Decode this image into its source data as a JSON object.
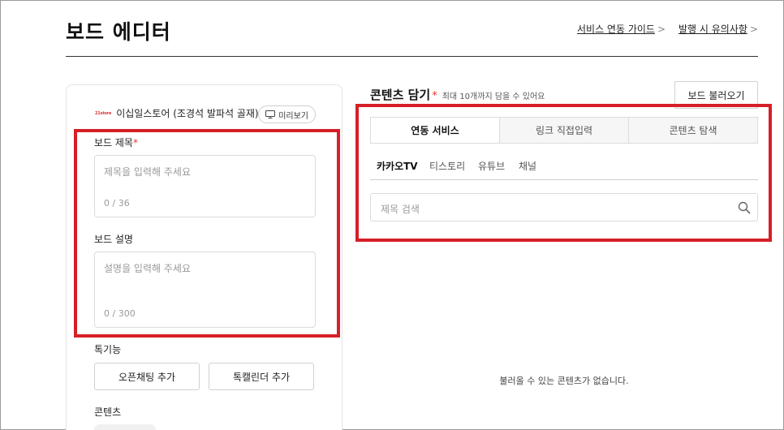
{
  "header": {
    "title": "보드 에디터",
    "links": [
      {
        "label": "서비스 연동 가이드",
        "chevron": ">"
      },
      {
        "label": "발행 시 유의사항",
        "chevron": ">"
      }
    ]
  },
  "left": {
    "store_logo": "21store",
    "store_name": "이십일스토어 (조경석 발파석 골재)",
    "preview_label": "미리보기",
    "title_field": {
      "label": "보드 제목",
      "required_mark": "*",
      "placeholder": "제목을 입력해 주세요",
      "counter": "0 / 36"
    },
    "desc_field": {
      "label": "보드 설명",
      "placeholder": "설명을 입력해 주세요",
      "counter": "0 / 300"
    },
    "features_label": "톡기능",
    "feature_buttons": [
      "오픈채팅 추가",
      "톡캘린더 추가"
    ],
    "contents_label": "콘텐츠"
  },
  "right": {
    "title": "콘텐츠 담기",
    "required_mark": "*",
    "subtitle": "최대 10개까지 담을 수 있어요",
    "load_button": "보드 불러오기",
    "tabs": [
      "연동 서비스",
      "링크 직접입력",
      "콘텐츠 탐색"
    ],
    "subtabs": [
      "카카오TV",
      "티스토리",
      "유튜브",
      "채널"
    ],
    "search_placeholder": "제목 검색",
    "empty_message": "불러올 수 있는 콘텐츠가 없습니다."
  },
  "colors": {
    "highlight": "#d61f26",
    "required": "#e33333"
  }
}
